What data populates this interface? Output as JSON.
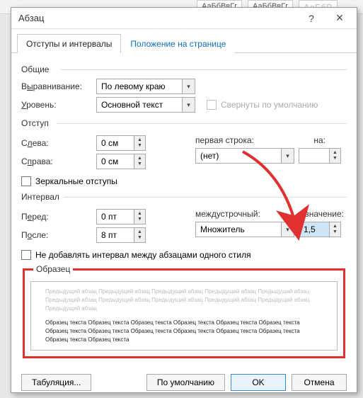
{
  "ribbon": {
    "style1": "АаБбВвГг",
    "style2": "АаБбВвГг",
    "style3": "АаБбВ"
  },
  "dialog": {
    "title": "Абзац",
    "help": "?",
    "close": "×"
  },
  "tabs": {
    "indents": "Отступы и интервалы",
    "position": "Положение на странице"
  },
  "general": {
    "section": "Общие",
    "alignment_label_pre": "В",
    "alignment_label_u": "ы",
    "alignment_label_post": "равнивание:",
    "alignment_value": "По левому краю",
    "level_label_pre": "",
    "level_label_u": "У",
    "level_label_post": "ровень:",
    "level_value": "Основной текст",
    "collapse_label": "Свернуты по умолчанию"
  },
  "indent": {
    "section": "Отступ",
    "left_label_pre": "С",
    "left_label_u": "л",
    "left_label_post": "ева:",
    "left_value": "0 см",
    "right_label_pre": "С",
    "right_label_u": "п",
    "right_label_post": "рава:",
    "right_value": "0 см",
    "first_line_label_pre": "перва",
    "first_line_label_u": "я",
    "first_line_label_post": " строка:",
    "first_line_value": "(нет)",
    "on_label_pre": "",
    "on_label_u": "н",
    "on_label_post": "а:",
    "mirror_label_pre": "",
    "mirror_label_u": "З",
    "mirror_label_post": "еркальные отступы"
  },
  "spacing": {
    "section": "Интервал",
    "before_label_pre": "П",
    "before_label_u": "е",
    "before_label_post": "ред:",
    "before_value": "0 пт",
    "after_label_pre": "П",
    "after_label_u": "о",
    "after_label_post": "сле:",
    "after_value": "8 пт",
    "line_label_pre": "",
    "line_label_u": "м",
    "line_label_post": "еждустрочный:",
    "line_value": "Множитель",
    "value_label_pre": "",
    "value_label_u": "з",
    "value_label_post": "начение:",
    "value_value": "1,5",
    "noadd_label": "Не добавлять интервал между абзацами одного стиля"
  },
  "sample": {
    "section": "Образец",
    "prev_text": "Предыдущий абзац Предыдущий абзац Предыдущий абзац Предыдущий абзац Предыдущий абзац Предыдущий абзац Предыдущий абзац Предыдущий абзац Предыдущий абзац Предыдущий абзац Предыдущий абзац",
    "sample_text": "Образец текста Образец текста Образец текста Образец текста Образец текста Образец текста Образец текста Образец текста Образец текста Образец текста Образец текста Образец текста Образец текста Образец текста"
  },
  "buttons": {
    "tabs": "Табуляция...",
    "default": "По умолчанию",
    "ok": "OK",
    "cancel": "Отмена"
  }
}
